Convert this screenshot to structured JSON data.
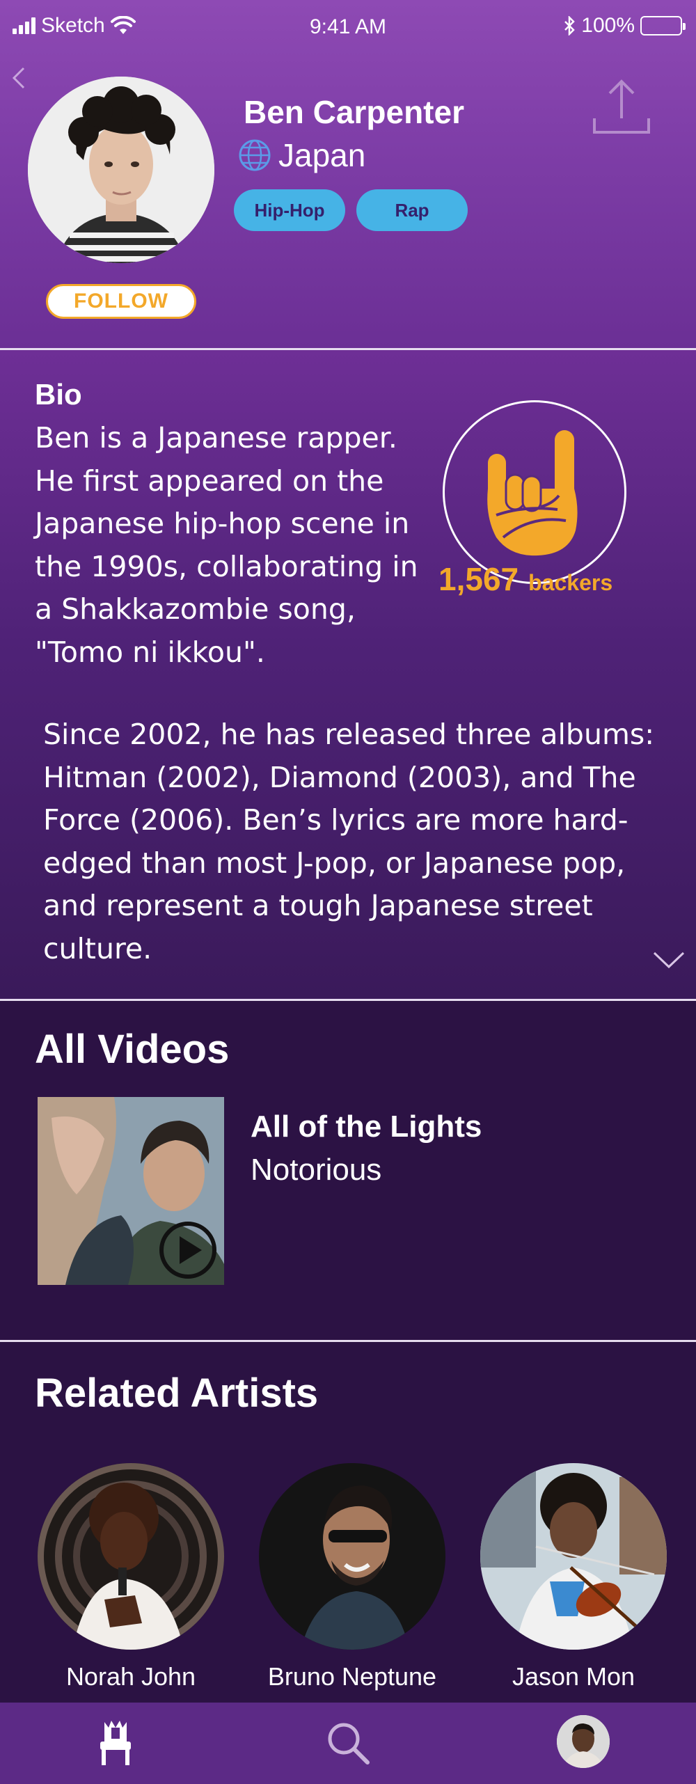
{
  "status_bar": {
    "carrier": "Sketch",
    "time": "9:41 AM",
    "battery": "100%",
    "icons": [
      "signal-icon",
      "wifi-icon",
      "bluetooth-icon",
      "battery-icon"
    ]
  },
  "header": {
    "artist_name": "Ben Carpenter",
    "country": "Japan",
    "tags": [
      "Hip-Hop",
      "Rap"
    ],
    "follow_label": "FOLLOW",
    "icons": [
      "back-icon",
      "share-icon",
      "globe-icon"
    ]
  },
  "bio": {
    "title": "Bio",
    "paragraph_1": "Ben is a Japanese rapper. He first appeared on the Japanese hip-hop scene in the 1990s, collaborating in a Shakkazombie song, \"Tomo ni ikkou\".",
    "paragraph_2": "Since 2002, he has released three albums: Hitman (2002), Diamond (2003), and The Force (2006). Ben’s lyrics are more hard-edged than most J-pop, or Japanese pop, and represent a tough Japanese street culture.",
    "backers_count": "1,567",
    "backers_label": "backers"
  },
  "videos": {
    "title": "All Videos",
    "items": [
      {
        "title": "All of the Lights",
        "artist": "Notorious"
      }
    ]
  },
  "related": {
    "title": "Related Artists",
    "artists": [
      {
        "name": "Norah John"
      },
      {
        "name": "Bruno Neptune"
      },
      {
        "name": "Jason Mon"
      }
    ]
  },
  "tab_bar": {
    "icons": [
      "throne-icon",
      "search-icon",
      "profile-avatar"
    ]
  },
  "colors": {
    "header_purple": "#8e4ab4",
    "tag_blue": "#46b3e6",
    "accent_orange": "#f3a82a",
    "dark_purple": "#2c1244",
    "tab_bar": "#5c2a86"
  }
}
